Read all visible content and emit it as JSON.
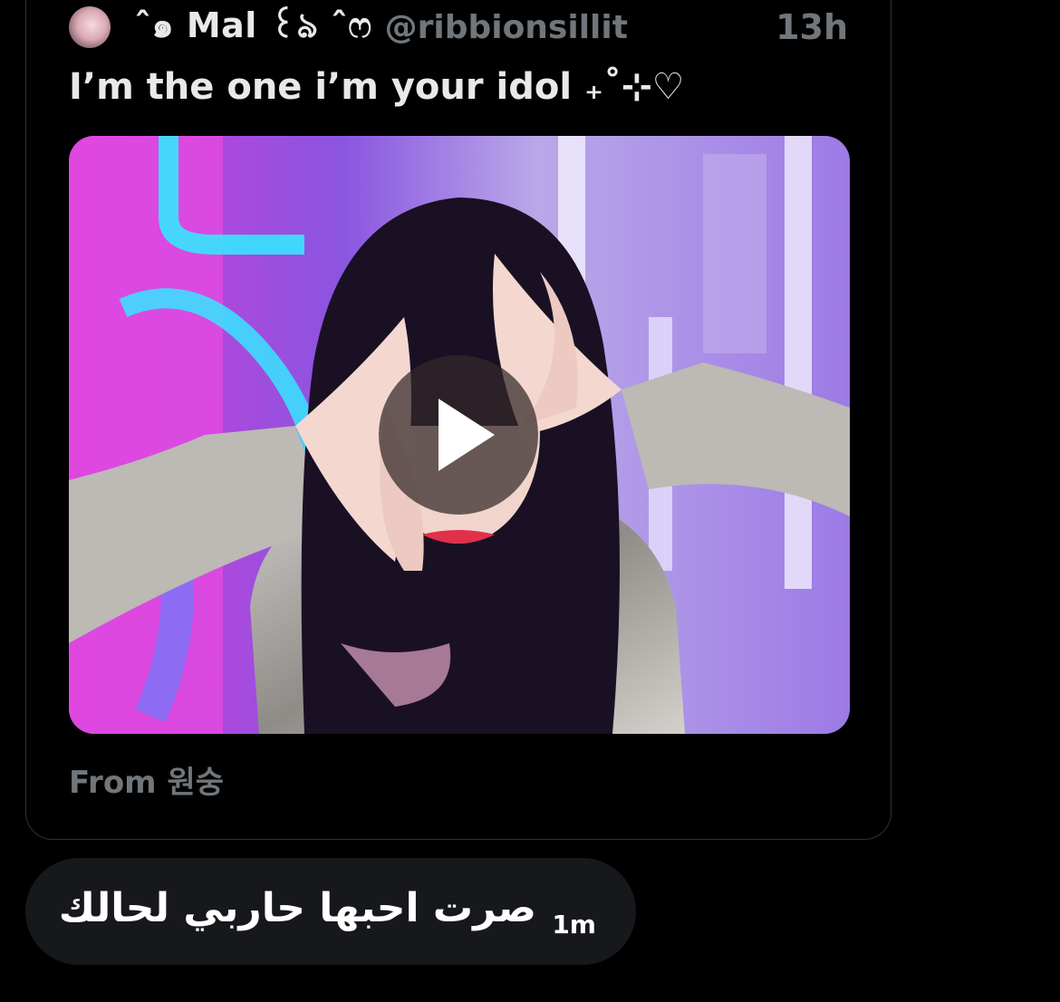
{
  "quoted_tweet": {
    "author": {
      "display_name": "ˆ๑ Mal ꒰ঌ ˆෆ",
      "handle": "@ribbionsillit",
      "avatar_icon": "avatar-photo"
    },
    "time_ago": "13h",
    "text": "I’m the one i’m your idol ₊˚⊹♡",
    "media": {
      "type": "video",
      "play_icon": "play-icon"
    },
    "attribution": "From 원숭"
  },
  "reply": {
    "text": "صرت احبها حاربي لحالك",
    "time_ago": "1m"
  },
  "colors": {
    "background": "#000000",
    "text_primary": "#e7e9ea",
    "text_secondary": "#71767b",
    "bubble": "#16181c",
    "border": "#2f3336"
  }
}
